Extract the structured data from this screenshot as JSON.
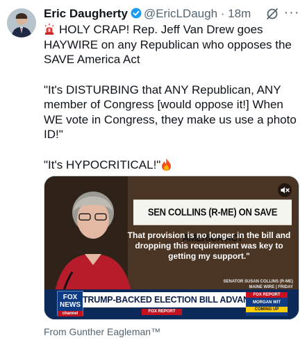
{
  "author": {
    "name": "Eric Daugherty",
    "handle": "@EricLDaugh",
    "separator": "·",
    "time": "18m"
  },
  "icons": {
    "verified": "verified-badge-icon",
    "grok": "grok-icon",
    "siren": "siren-icon",
    "fire": "fire-icon",
    "mute": "speaker-mute-icon"
  },
  "colors": {
    "verified": "#1d9bf0",
    "secondary_text": "#536471",
    "fox_blue": "#0b2a5a",
    "fox_red": "#c4111f"
  },
  "tweet": {
    "line1": "HOLY CRAP! Rep. Jeff Van Drew goes HAYWIRE on any Republican who opposes the SAVE America Act",
    "line2": "\"It's DISTURBING that ANY Republican, ANY member of Congress [would oppose it!] When WE vote in Congress, they make us use a photo ID!\"",
    "line3": "\"It's HYPOCRITICAL!\""
  },
  "media": {
    "banner_title": "SEN COLLINS (R-ME) ON SAVE AMERICA ACT",
    "quote": "That provision is no longer in the bill and dropping this requirement was key to getting my support.\"",
    "attribution_line1": "SENATOR SUSAN COLLINS (R-ME)",
    "attribution_line2": "MAINE WIRE | FRIDAY",
    "logo_line1": "FOX",
    "logo_line2": "NEWS",
    "logo_line3": "channel",
    "headline": "TRUMP-BACKED ELECTION BILL ADVANCES",
    "fox_report": "FOX REPORT",
    "right_report": "FOX REPORT",
    "right_name": "MORGAN WIT",
    "right_coming": "COMING UP"
  },
  "attribution": "From Gunther Eagleman™"
}
